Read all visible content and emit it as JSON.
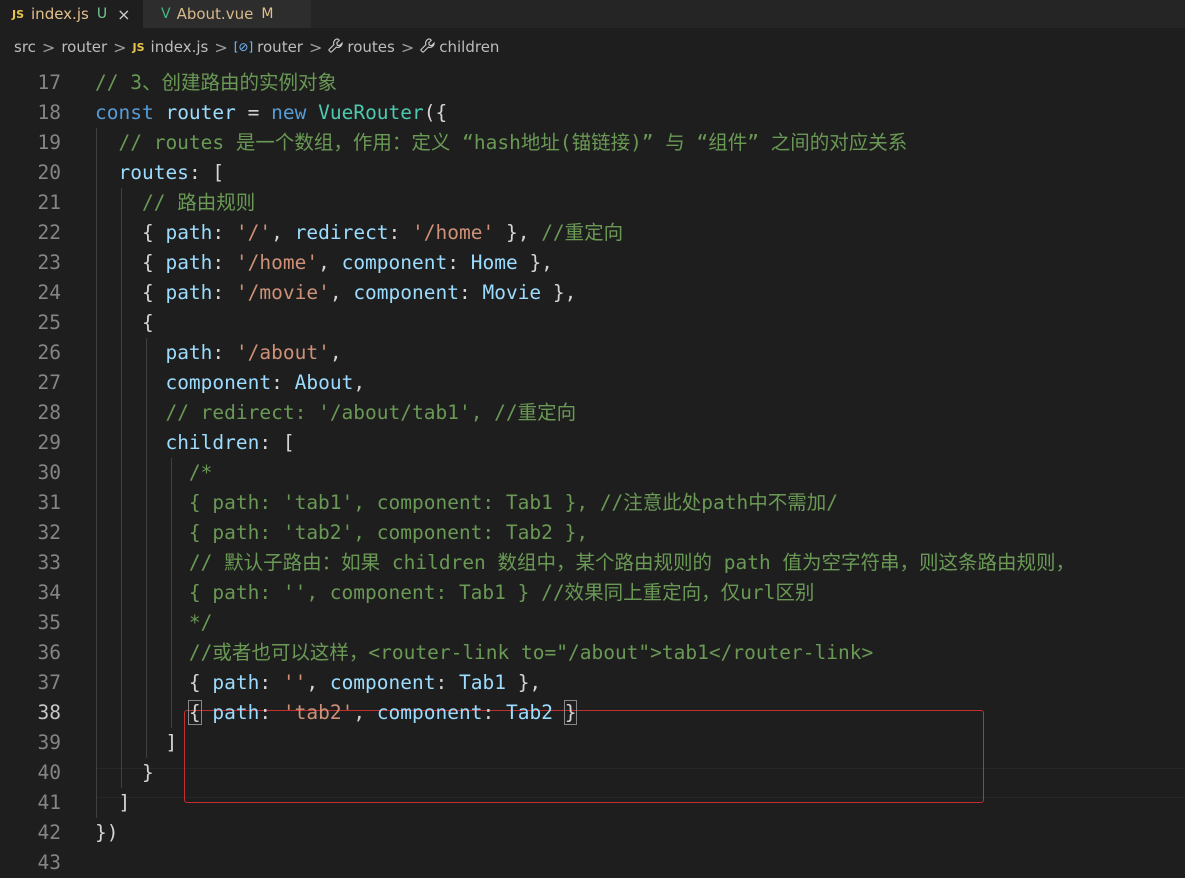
{
  "tabs": [
    {
      "icon": "JS",
      "label": "index.js",
      "status": "U",
      "close": "×",
      "status_color": "#73c991"
    },
    {
      "icon": "V",
      "label": "About.vue",
      "status": "M",
      "status_color": "#e2c08d"
    }
  ],
  "breadcrumb": [
    {
      "label": "src",
      "icon": ""
    },
    {
      "label": "router",
      "icon": ""
    },
    {
      "label": "index.js",
      "icon": "JS"
    },
    {
      "label": "router",
      "icon": "[⊘]"
    },
    {
      "label": "routes",
      "icon": "wrench"
    },
    {
      "label": "children",
      "icon": "wrench"
    }
  ],
  "breadcrumb_separator": ">",
  "lines": [
    {
      "n": "17",
      "tokens": [
        [
          "c",
          "// 3、创建路由的实例对象"
        ]
      ]
    },
    {
      "n": "18",
      "tokens": [
        [
          "k",
          "const "
        ],
        [
          "v",
          "router"
        ],
        [
          "p",
          " = "
        ],
        [
          "k",
          "new "
        ],
        [
          "t",
          "VueRouter"
        ],
        [
          "p",
          "({"
        ]
      ]
    },
    {
      "n": "19",
      "tokens": [
        [
          "p",
          "  "
        ],
        [
          "c",
          "// routes 是一个数组，作用：定义 “hash地址(锚链接)” 与 “组件” 之间的对应关系"
        ]
      ]
    },
    {
      "n": "20",
      "tokens": [
        [
          "p",
          "  "
        ],
        [
          "v",
          "routes"
        ],
        [
          "p",
          ": ["
        ]
      ]
    },
    {
      "n": "21",
      "tokens": [
        [
          "p",
          "    "
        ],
        [
          "c",
          "// 路由规则"
        ]
      ]
    },
    {
      "n": "22",
      "tokens": [
        [
          "p",
          "    { "
        ],
        [
          "v",
          "path"
        ],
        [
          "p",
          ": "
        ],
        [
          "s",
          "'/'"
        ],
        [
          "p",
          ", "
        ],
        [
          "v",
          "redirect"
        ],
        [
          "p",
          ": "
        ],
        [
          "s",
          "'/home'"
        ],
        [
          "p",
          " }, "
        ],
        [
          "c",
          "//重定向"
        ]
      ]
    },
    {
      "n": "23",
      "tokens": [
        [
          "p",
          "    { "
        ],
        [
          "v",
          "path"
        ],
        [
          "p",
          ": "
        ],
        [
          "s",
          "'/home'"
        ],
        [
          "p",
          ", "
        ],
        [
          "v",
          "component"
        ],
        [
          "p",
          ": "
        ],
        [
          "v",
          "Home"
        ],
        [
          "p",
          " },"
        ]
      ]
    },
    {
      "n": "24",
      "tokens": [
        [
          "p",
          "    { "
        ],
        [
          "v",
          "path"
        ],
        [
          "p",
          ": "
        ],
        [
          "s",
          "'/movie'"
        ],
        [
          "p",
          ", "
        ],
        [
          "v",
          "component"
        ],
        [
          "p",
          ": "
        ],
        [
          "v",
          "Movie"
        ],
        [
          "p",
          " },"
        ]
      ]
    },
    {
      "n": "25",
      "tokens": [
        [
          "p",
          "    {"
        ]
      ]
    },
    {
      "n": "26",
      "tokens": [
        [
          "p",
          "      "
        ],
        [
          "v",
          "path"
        ],
        [
          "p",
          ": "
        ],
        [
          "s",
          "'/about'"
        ],
        [
          "p",
          ","
        ]
      ]
    },
    {
      "n": "27",
      "tokens": [
        [
          "p",
          "      "
        ],
        [
          "v",
          "component"
        ],
        [
          "p",
          ": "
        ],
        [
          "v",
          "About"
        ],
        [
          "p",
          ","
        ]
      ]
    },
    {
      "n": "28",
      "tokens": [
        [
          "p",
          "      "
        ],
        [
          "c",
          "// redirect: '/about/tab1', //重定向"
        ]
      ]
    },
    {
      "n": "29",
      "tokens": [
        [
          "p",
          "      "
        ],
        [
          "v",
          "children"
        ],
        [
          "p",
          ": ["
        ]
      ]
    },
    {
      "n": "30",
      "tokens": [
        [
          "p",
          "        "
        ],
        [
          "c",
          "/*"
        ]
      ]
    },
    {
      "n": "31",
      "tokens": [
        [
          "p",
          "        "
        ],
        [
          "c",
          "{ path: 'tab1', component: Tab1 }, //注意此处path中不需加/"
        ]
      ]
    },
    {
      "n": "32",
      "tokens": [
        [
          "p",
          "        "
        ],
        [
          "c",
          "{ path: 'tab2', component: Tab2 },"
        ]
      ]
    },
    {
      "n": "33",
      "tokens": [
        [
          "p",
          "        "
        ],
        [
          "c",
          "// 默认子路由：如果 children 数组中，某个路由规则的 path 值为空字符串，则这条路由规则，"
        ]
      ]
    },
    {
      "n": "34",
      "tokens": [
        [
          "p",
          "        "
        ],
        [
          "c",
          "{ path: '', component: Tab1 } //效果同上重定向，仅url区别"
        ]
      ]
    },
    {
      "n": "35",
      "tokens": [
        [
          "p",
          "        "
        ],
        [
          "c",
          "*/"
        ]
      ]
    },
    {
      "n": "36",
      "tokens": [
        [
          "p",
          "        "
        ],
        [
          "c",
          "//或者也可以这样，<router-link to=\"/about\">tab1</router-link>"
        ]
      ]
    },
    {
      "n": "37",
      "tokens": [
        [
          "p",
          "        { "
        ],
        [
          "v",
          "path"
        ],
        [
          "p",
          ": "
        ],
        [
          "s",
          "''"
        ],
        [
          "p",
          ", "
        ],
        [
          "v",
          "component"
        ],
        [
          "p",
          ": "
        ],
        [
          "v",
          "Tab1"
        ],
        [
          "p",
          " },"
        ]
      ]
    },
    {
      "n": "38",
      "tokens": [
        [
          "p",
          "        "
        ],
        [
          "p",
          "{",
          "m"
        ],
        [
          "p",
          " "
        ],
        [
          "v",
          "path"
        ],
        [
          "p",
          ": "
        ],
        [
          "s",
          "'tab2'"
        ],
        [
          "p",
          ", "
        ],
        [
          "v",
          "component"
        ],
        [
          "p",
          ": "
        ],
        [
          "v",
          "Tab2"
        ],
        [
          "p",
          " "
        ],
        [
          "p",
          "}",
          "m"
        ]
      ]
    },
    {
      "n": "39",
      "tokens": [
        [
          "p",
          "      ]"
        ]
      ]
    },
    {
      "n": "40",
      "tokens": [
        [
          "p",
          "    }"
        ]
      ]
    },
    {
      "n": "41",
      "tokens": [
        [
          "p",
          "  ]"
        ]
      ]
    },
    {
      "n": "42",
      "tokens": [
        [
          "p",
          "})"
        ]
      ]
    },
    {
      "n": "43",
      "tokens": []
    }
  ]
}
